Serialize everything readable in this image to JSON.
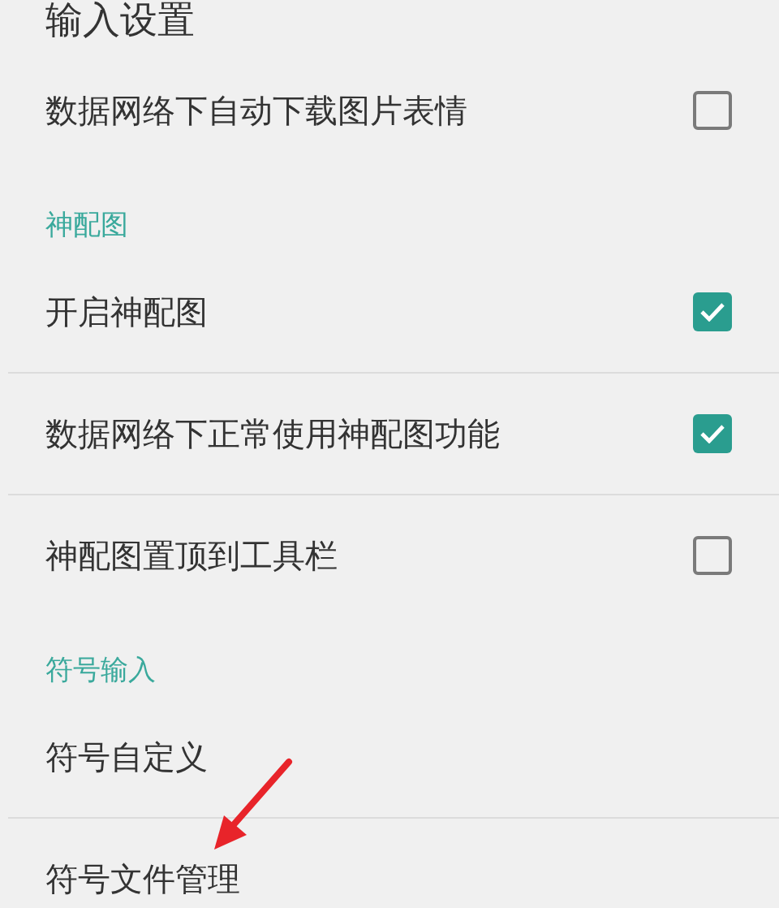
{
  "title": "输入设置",
  "sections": [
    {
      "items": [
        {
          "label": "数据网络下自动下载图片表情",
          "kind": "checkbox",
          "checked": false
        }
      ]
    },
    {
      "header": "神配图",
      "items": [
        {
          "label": "开启神配图",
          "kind": "checkbox",
          "checked": true
        },
        {
          "label": "数据网络下正常使用神配图功能",
          "kind": "checkbox",
          "checked": true
        },
        {
          "label": "神配图置顶到工具栏",
          "kind": "checkbox",
          "checked": false
        }
      ]
    },
    {
      "header": "符号输入",
      "items": [
        {
          "label": "符号自定义",
          "kind": "link"
        },
        {
          "label": "符号文件管理",
          "kind": "link"
        }
      ]
    }
  ]
}
